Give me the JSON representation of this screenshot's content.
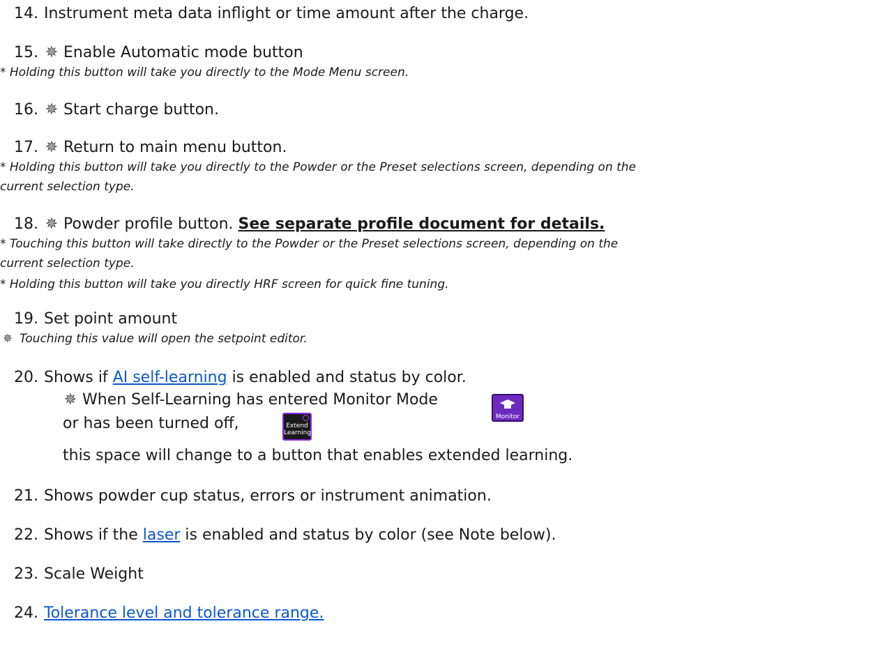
{
  "items": {
    "i14": {
      "num": "14.",
      "text": "Instrument meta data inflight or time amount after the charge."
    },
    "i15": {
      "num": "15.",
      "text": "Enable Automatic mode button",
      "note": "* Holding this button will take you directly to the Mode Menu screen."
    },
    "i16": {
      "num": "16.",
      "text": "Start charge button."
    },
    "i17": {
      "num": "17.",
      "text": "Return to main menu button.",
      "note1": "* Holding this button will take you directly to the Powder or the Preset selections screen, depending on the",
      "note2": "current selection type."
    },
    "i18": {
      "num": "18.",
      "text": "Powder profile button.",
      "link": "See separate profile document for details.",
      "note1": "* Touching this button will take directly to the Powder or the Preset selections screen, depending on the",
      "note2": "current selection type.",
      "note3": "* Holding this button will take you directly HRF screen for quick fine tuning."
    },
    "i19": {
      "num": "19.",
      "text": "Set point amount",
      "note": "Touching this value will open the setpoint editor."
    },
    "i20": {
      "num": "20.",
      "pre": "Shows if",
      "link": "AI self-learning",
      "post": "is enabled and status by color.",
      "sub1": "When Self-Learning has entered Monitor Mode",
      "sub2": "or has been turned off,",
      "sub3": "this space will change to a button that enables extended learning.",
      "btn_extend": "Extend Learning",
      "btn_monitor": "Monitor"
    },
    "i21": {
      "num": "21.",
      "text": "Shows powder cup status, errors or instrument animation."
    },
    "i22": {
      "num": "22.",
      "pre": "Shows if the",
      "link": "laser",
      "post": "is enabled and status by color (see Note below)."
    },
    "i23": {
      "num": "23.",
      "text": "Scale Weight"
    },
    "i24": {
      "num": "24.",
      "link": "Tolerance level and tolerance range."
    }
  },
  "icons": {
    "touch": "touch-icon",
    "glyph": "✵"
  },
  "colors": {
    "link": "#0b57d0",
    "accent": "#8a2be2"
  }
}
